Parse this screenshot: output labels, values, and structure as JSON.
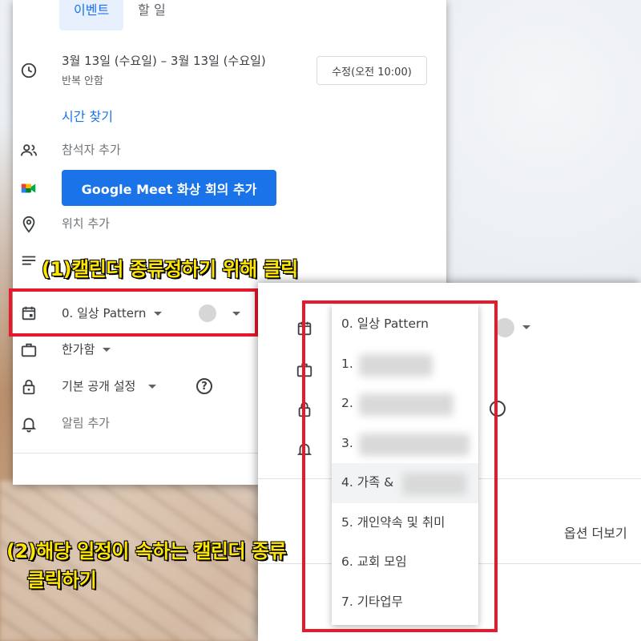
{
  "tabs": [
    "이벤트",
    "할 일"
  ],
  "datetime": {
    "range": "3월 13일 (수요일)  –  3월 13일 (수요일)",
    "repeat": "반복 안함",
    "timezone_button": "수정(오전 10:00)"
  },
  "find_time": "시간 찾기",
  "add_guests": "참석자 추가",
  "meet_button": "Google Meet 화상 회의 추가",
  "add_location": "위치 추가",
  "calendar_select": "0. 일상 Pattern",
  "busy_select": "한가함",
  "visibility_select": "기본 공개 설정",
  "help_symbol": "?",
  "add_notification": "알림 추가",
  "dropdown": {
    "items": [
      "0. 일상 Pattern",
      "1.",
      "2.",
      "3.",
      "4. 가족 &",
      "5. 개인약속 및 취미",
      "6. 교회 모임",
      "7. 기타업무"
    ]
  },
  "more_options": "옵션 더보기",
  "annotations": {
    "step1": "(1)캘린더 종류정하기 위해 클릭",
    "step2_line1": "(2)해당 일정이 속하는 캘린더 종류",
    "step2_line2": "클릭하기"
  },
  "colors": {
    "accent": "#1a73e8",
    "highlight": "#e8192c",
    "caption": "#ffe600"
  }
}
